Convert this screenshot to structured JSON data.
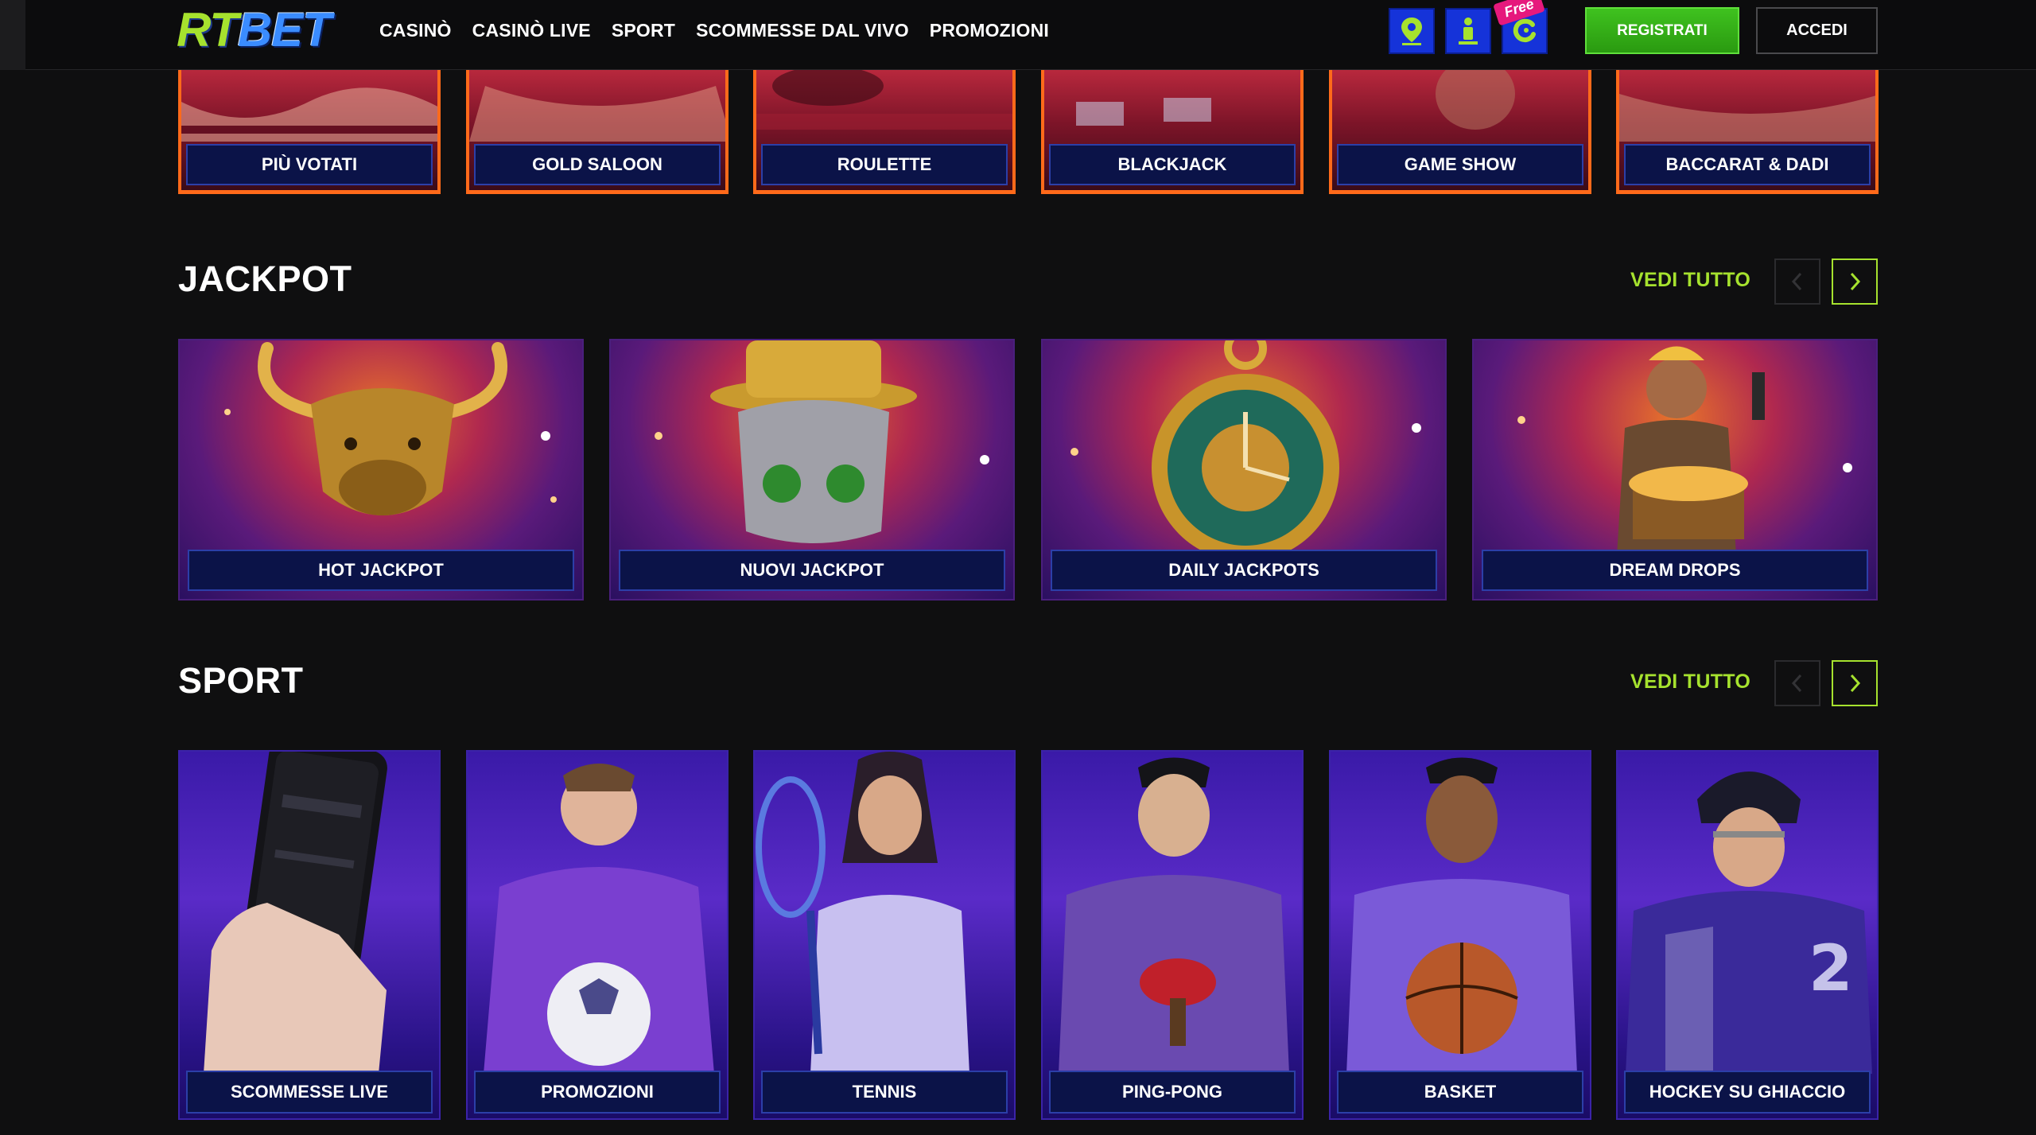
{
  "header": {
    "logo_rt": "RT",
    "logo_bet": "BET",
    "nav": [
      "CASINÒ",
      "CASINÒ LIVE",
      "SPORT",
      "SCOMMESSE DAL VIVO",
      "PROMOZIONI"
    ],
    "icons": [
      "map-pin-icon",
      "person-icon",
      "chat-icon"
    ],
    "free_badge": "Free",
    "register_label": "REGISTRATI",
    "login_label": "ACCEDI"
  },
  "top_row": [
    "PIÙ VOTATI",
    "GOLD SALOON",
    "ROULETTE",
    "BLACKJACK",
    "GAME SHOW",
    "BACCARAT & DADI"
  ],
  "jackpot": {
    "title": "JACKPOT",
    "see_all": "VEDI TUTTO",
    "cards": [
      "HOT JACKPOT",
      "NUOVI JACKPOT",
      "DAILY JACKPOTS",
      "DREAM DROPS"
    ]
  },
  "sport": {
    "title": "SPORT",
    "see_all": "VEDI TUTTO",
    "cards": [
      "SCOMMESSE LIVE",
      "PROMOZIONI",
      "TENNIS",
      "PING-PONG",
      "BASKET",
      "HOCKEY SU GHIACCIO"
    ]
  },
  "colors": {
    "accent": "#a6e22e",
    "register_green": "#3fc21f",
    "label_bar": "#0b1348",
    "top_border": "#ff6a1a"
  }
}
